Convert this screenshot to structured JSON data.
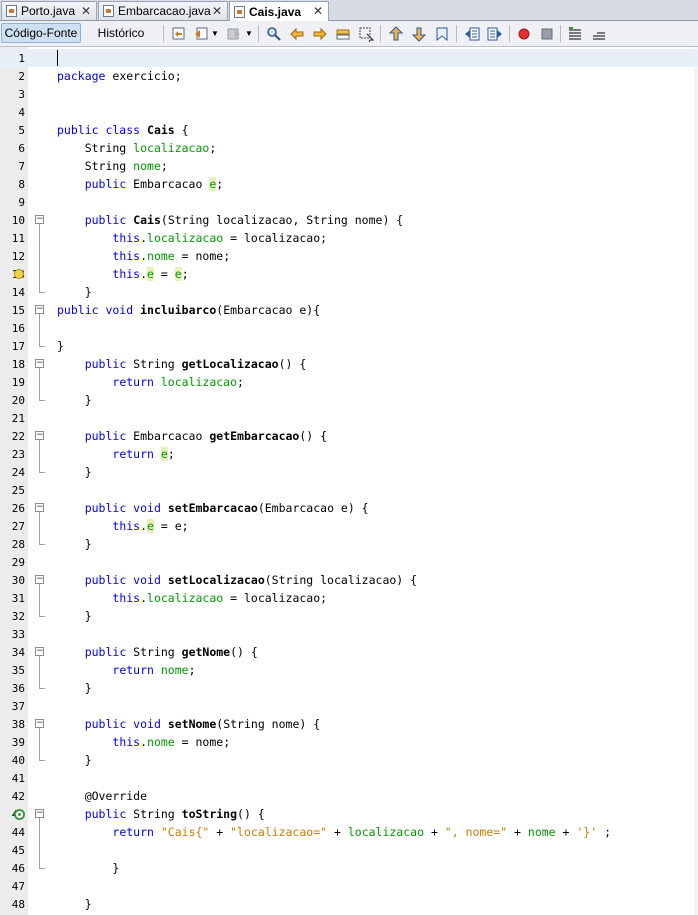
{
  "tabs": [
    {
      "label": "Porto.java",
      "close": "✕"
    },
    {
      "label": "Embarcacao.java",
      "close": "✕"
    },
    {
      "label": "Cais.java",
      "close": "✕",
      "active": true
    }
  ],
  "toolbar": {
    "source_label": "Código-Fonte",
    "history_label": "Histórico",
    "icons": [
      "last-edit-icon",
      "back-icon",
      "forward-icon",
      "find-icon",
      "find-previous-icon",
      "find-next-icon",
      "find-selection-icon",
      "toggle-highlight-icon",
      "previous-bookmark-icon",
      "next-bookmark-icon",
      "toggle-bookmark-icon",
      "shift-left-icon",
      "shift-right-icon",
      "start-macro-icon",
      "stop-macro-icon",
      "comment-icon",
      "uncomment-icon"
    ]
  },
  "editor": {
    "current_line": 1,
    "lines": [
      {
        "n": "1",
        "t": []
      },
      {
        "n": "2",
        "t": [
          {
            "k": "kw",
            "v": "package"
          },
          {
            "v": " exercicio;"
          }
        ]
      },
      {
        "n": "3",
        "t": []
      },
      {
        "n": "4",
        "t": []
      },
      {
        "n": "5",
        "t": [
          {
            "k": "kw",
            "v": "public class"
          },
          {
            "v": " "
          },
          {
            "k": "b",
            "v": "Cais"
          },
          {
            "v": " {"
          }
        ]
      },
      {
        "n": "6",
        "t": [
          {
            "v": "    String "
          },
          {
            "k": "fd",
            "v": "localizacao"
          },
          {
            "v": ";"
          }
        ]
      },
      {
        "n": "7",
        "t": [
          {
            "v": "    String "
          },
          {
            "k": "fd",
            "v": "nome"
          },
          {
            "v": ";"
          }
        ]
      },
      {
        "n": "8",
        "t": [
          {
            "v": "    "
          },
          {
            "k": "kw",
            "v": "public"
          },
          {
            "v": " Embarcacao "
          },
          {
            "k": "fd hl",
            "v": "e"
          },
          {
            "v": ";"
          }
        ]
      },
      {
        "n": "9",
        "t": []
      },
      {
        "n": "10",
        "t": [
          {
            "v": "    "
          },
          {
            "k": "kw",
            "v": "public"
          },
          {
            "v": " "
          },
          {
            "k": "b",
            "v": "Cais"
          },
          {
            "v": "(String localizacao, String nome) {"
          }
        ]
      },
      {
        "n": "11",
        "t": [
          {
            "v": "        "
          },
          {
            "k": "kw",
            "v": "this"
          },
          {
            "v": "."
          },
          {
            "k": "fd",
            "v": "localizacao"
          },
          {
            "v": " = localizacao;"
          }
        ]
      },
      {
        "n": "12",
        "t": [
          {
            "v": "        "
          },
          {
            "k": "kw",
            "v": "this"
          },
          {
            "v": "."
          },
          {
            "k": "fd",
            "v": "nome"
          },
          {
            "v": " = nome;"
          }
        ]
      },
      {
        "n": "13",
        "t": [
          {
            "v": "        "
          },
          {
            "k": "kw",
            "v": "this"
          },
          {
            "v": "."
          },
          {
            "k": "fd hl",
            "v": "e"
          },
          {
            "v": " = "
          },
          {
            "k": "fd hl",
            "v": "e"
          },
          {
            "v": ";"
          }
        ]
      },
      {
        "n": "14",
        "t": [
          {
            "v": "    }"
          }
        ]
      },
      {
        "n": "15",
        "t": [
          {
            "k": "kw",
            "v": "public void"
          },
          {
            "v": " "
          },
          {
            "k": "b",
            "v": "incluibarco"
          },
          {
            "v": "(Embarcacao e){"
          }
        ]
      },
      {
        "n": "16",
        "t": []
      },
      {
        "n": "17",
        "t": [
          {
            "v": "}"
          }
        ]
      },
      {
        "n": "18",
        "t": [
          {
            "v": "    "
          },
          {
            "k": "kw",
            "v": "public"
          },
          {
            "v": " String "
          },
          {
            "k": "b",
            "v": "getLocalizacao"
          },
          {
            "v": "() {"
          }
        ]
      },
      {
        "n": "19",
        "t": [
          {
            "v": "        "
          },
          {
            "k": "kw",
            "v": "return"
          },
          {
            "v": " "
          },
          {
            "k": "fd",
            "v": "localizacao"
          },
          {
            "v": ";"
          }
        ]
      },
      {
        "n": "20",
        "t": [
          {
            "v": "    }"
          }
        ]
      },
      {
        "n": "21",
        "t": []
      },
      {
        "n": "22",
        "t": [
          {
            "v": "    "
          },
          {
            "k": "kw",
            "v": "public"
          },
          {
            "v": " Embarcacao "
          },
          {
            "k": "b",
            "v": "getEmbarcacao"
          },
          {
            "v": "() {"
          }
        ]
      },
      {
        "n": "23",
        "t": [
          {
            "v": "        "
          },
          {
            "k": "kw",
            "v": "return"
          },
          {
            "v": " "
          },
          {
            "k": "fd hl",
            "v": "e"
          },
          {
            "v": ";"
          }
        ]
      },
      {
        "n": "24",
        "t": [
          {
            "v": "    }"
          }
        ]
      },
      {
        "n": "25",
        "t": []
      },
      {
        "n": "26",
        "t": [
          {
            "v": "    "
          },
          {
            "k": "kw",
            "v": "public void"
          },
          {
            "v": " "
          },
          {
            "k": "b",
            "v": "setEmbarcacao"
          },
          {
            "v": "(Embarcacao e) {"
          }
        ]
      },
      {
        "n": "27",
        "t": [
          {
            "v": "        "
          },
          {
            "k": "kw",
            "v": "this"
          },
          {
            "v": "."
          },
          {
            "k": "fd hl",
            "v": "e"
          },
          {
            "v": " = e;"
          }
        ]
      },
      {
        "n": "28",
        "t": [
          {
            "v": "    }"
          }
        ]
      },
      {
        "n": "29",
        "t": []
      },
      {
        "n": "30",
        "t": [
          {
            "v": "    "
          },
          {
            "k": "kw",
            "v": "public void"
          },
          {
            "v": " "
          },
          {
            "k": "b",
            "v": "setLocalizacao"
          },
          {
            "v": "(String localizacao) {"
          }
        ]
      },
      {
        "n": "31",
        "t": [
          {
            "v": "        "
          },
          {
            "k": "kw",
            "v": "this"
          },
          {
            "v": "."
          },
          {
            "k": "fd",
            "v": "localizacao"
          },
          {
            "v": " = localizacao;"
          }
        ]
      },
      {
        "n": "32",
        "t": [
          {
            "v": "    }"
          }
        ]
      },
      {
        "n": "33",
        "t": []
      },
      {
        "n": "34",
        "t": [
          {
            "v": "    "
          },
          {
            "k": "kw",
            "v": "public"
          },
          {
            "v": " String "
          },
          {
            "k": "b",
            "v": "getNome"
          },
          {
            "v": "() {"
          }
        ]
      },
      {
        "n": "35",
        "t": [
          {
            "v": "        "
          },
          {
            "k": "kw",
            "v": "return"
          },
          {
            "v": " "
          },
          {
            "k": "fd",
            "v": "nome"
          },
          {
            "v": ";"
          }
        ]
      },
      {
        "n": "36",
        "t": [
          {
            "v": "    }"
          }
        ]
      },
      {
        "n": "37",
        "t": []
      },
      {
        "n": "38",
        "t": [
          {
            "v": "    "
          },
          {
            "k": "kw",
            "v": "public void"
          },
          {
            "v": " "
          },
          {
            "k": "b",
            "v": "setNome"
          },
          {
            "v": "(String nome) {"
          }
        ]
      },
      {
        "n": "39",
        "t": [
          {
            "v": "        "
          },
          {
            "k": "kw",
            "v": "this"
          },
          {
            "v": "."
          },
          {
            "k": "fd",
            "v": "nome"
          },
          {
            "v": " = nome;"
          }
        ]
      },
      {
        "n": "40",
        "t": [
          {
            "v": "    }"
          }
        ]
      },
      {
        "n": "41",
        "t": []
      },
      {
        "n": "42",
        "t": [
          {
            "v": "    @Override"
          }
        ]
      },
      {
        "n": "43",
        "t": [
          {
            "v": "    "
          },
          {
            "k": "kw",
            "v": "public"
          },
          {
            "v": " String "
          },
          {
            "k": "b",
            "v": "toString"
          },
          {
            "v": "() {"
          }
        ]
      },
      {
        "n": "44",
        "t": [
          {
            "v": "        "
          },
          {
            "k": "kw",
            "v": "return"
          },
          {
            "v": " "
          },
          {
            "k": "st",
            "v": "\"Cais{\""
          },
          {
            "v": " + "
          },
          {
            "k": "st",
            "v": "\"localizacao=\""
          },
          {
            "v": " + "
          },
          {
            "k": "fd",
            "v": "localizacao"
          },
          {
            "v": " + "
          },
          {
            "k": "st",
            "v": "\", nome=\""
          },
          {
            "v": " + "
          },
          {
            "k": "fd",
            "v": "nome"
          },
          {
            "v": " + "
          },
          {
            "k": "st",
            "v": "'}'"
          },
          {
            "v": " ;"
          }
        ]
      },
      {
        "n": "45",
        "t": []
      },
      {
        "n": "46",
        "t": [
          {
            "v": "        }"
          }
        ]
      },
      {
        "n": "47",
        "t": []
      },
      {
        "n": "48",
        "t": [
          {
            "v": "    }"
          }
        ]
      }
    ],
    "folds": [
      {
        "start": "10",
        "end": "14"
      },
      {
        "start": "15",
        "end": "17"
      },
      {
        "start": "18",
        "end": "20"
      },
      {
        "start": "22",
        "end": "24"
      },
      {
        "start": "26",
        "end": "28"
      },
      {
        "start": "30",
        "end": "32"
      },
      {
        "start": "34",
        "end": "36"
      },
      {
        "start": "38",
        "end": "40"
      },
      {
        "start": "43",
        "end": "46"
      }
    ],
    "gutter_marks": [
      {
        "line": "13",
        "icon": "warning-bulb-icon"
      },
      {
        "line": "43",
        "icon": "override-icon"
      }
    ]
  }
}
